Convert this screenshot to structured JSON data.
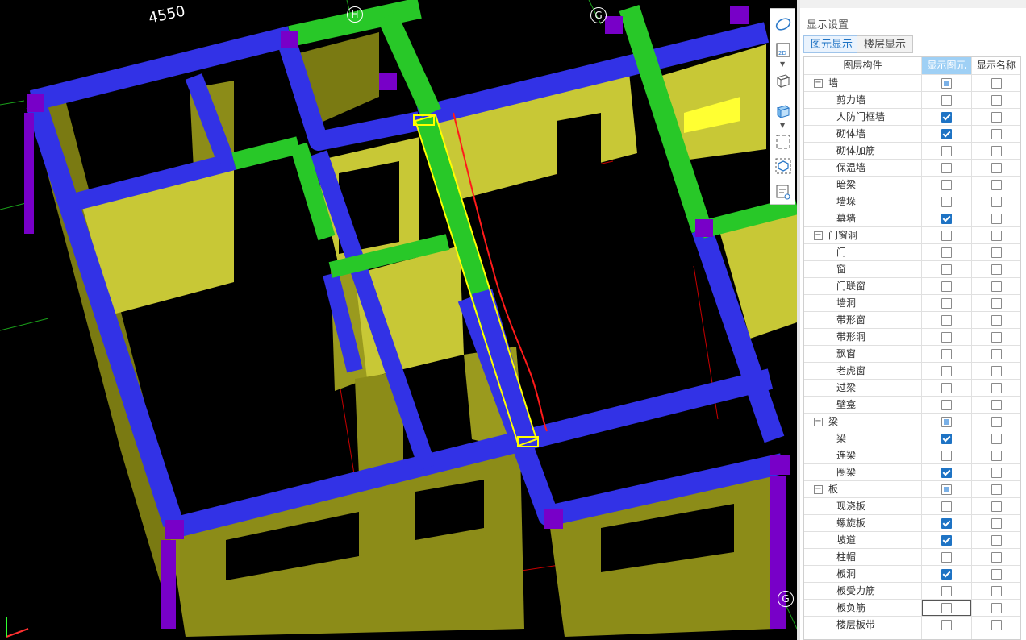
{
  "viewport": {
    "dimension_label": "4550",
    "grid_labels": [
      "H",
      "G",
      "G"
    ],
    "colors": {
      "background": "#000000",
      "wall": "#8c8c14",
      "wall_top": "#c8c832",
      "beam_blue": "#3232e6",
      "beam_green": "#28c828",
      "column": "#7800c8",
      "selection": "#ffff00",
      "annotation": "#ff0000"
    }
  },
  "toolbar": {
    "buttons": [
      "orbit-icon",
      "2d-view-icon",
      "3d-box-icon",
      "3d-solid-icon",
      "select-region-icon",
      "cube-view-icon",
      "display-settings-icon"
    ]
  },
  "panel": {
    "title": "显示设置",
    "tabs": [
      {
        "label": "图元显示",
        "active": true
      },
      {
        "label": "楼层显示",
        "active": false
      }
    ],
    "headers": {
      "component": "图层构件",
      "show_element": "显示图元",
      "show_name": "显示名称"
    },
    "rows": [
      {
        "label": "墙",
        "group": true,
        "show": "partial",
        "name": false
      },
      {
        "label": "剪力墙",
        "group": false,
        "show": false,
        "name": false
      },
      {
        "label": "人防门框墙",
        "group": false,
        "show": true,
        "name": false
      },
      {
        "label": "砌体墙",
        "group": false,
        "show": true,
        "name": false
      },
      {
        "label": "砌体加筋",
        "group": false,
        "show": false,
        "name": false
      },
      {
        "label": "保温墙",
        "group": false,
        "show": false,
        "name": false
      },
      {
        "label": "暗梁",
        "group": false,
        "show": false,
        "name": false
      },
      {
        "label": "墙垛",
        "group": false,
        "show": false,
        "name": false
      },
      {
        "label": "幕墙",
        "group": false,
        "show": true,
        "name": false
      },
      {
        "label": "门窗洞",
        "group": true,
        "show": false,
        "name": false
      },
      {
        "label": "门",
        "group": false,
        "show": false,
        "name": false
      },
      {
        "label": "窗",
        "group": false,
        "show": false,
        "name": false
      },
      {
        "label": "门联窗",
        "group": false,
        "show": false,
        "name": false
      },
      {
        "label": "墙洞",
        "group": false,
        "show": false,
        "name": false
      },
      {
        "label": "带形窗",
        "group": false,
        "show": false,
        "name": false
      },
      {
        "label": "带形洞",
        "group": false,
        "show": false,
        "name": false
      },
      {
        "label": "飘窗",
        "group": false,
        "show": false,
        "name": false
      },
      {
        "label": "老虎窗",
        "group": false,
        "show": false,
        "name": false
      },
      {
        "label": "过梁",
        "group": false,
        "show": false,
        "name": false
      },
      {
        "label": "壁龛",
        "group": false,
        "show": false,
        "name": false
      },
      {
        "label": "梁",
        "group": true,
        "show": "partial",
        "name": false
      },
      {
        "label": "梁",
        "group": false,
        "show": true,
        "name": false
      },
      {
        "label": "连梁",
        "group": false,
        "show": false,
        "name": false
      },
      {
        "label": "圈梁",
        "group": false,
        "show": true,
        "name": false
      },
      {
        "label": "板",
        "group": true,
        "show": "partial",
        "name": false
      },
      {
        "label": "现浇板",
        "group": false,
        "show": false,
        "name": false
      },
      {
        "label": "螺旋板",
        "group": false,
        "show": true,
        "name": false
      },
      {
        "label": "坡道",
        "group": false,
        "show": true,
        "name": false
      },
      {
        "label": "柱帽",
        "group": false,
        "show": false,
        "name": false
      },
      {
        "label": "板洞",
        "group": false,
        "show": true,
        "name": false
      },
      {
        "label": "板受力筋",
        "group": false,
        "show": false,
        "name": false
      },
      {
        "label": "板负筋",
        "group": false,
        "show": false,
        "name": false
      },
      {
        "label": "楼层板带",
        "group": false,
        "show": false,
        "name": false
      }
    ]
  }
}
